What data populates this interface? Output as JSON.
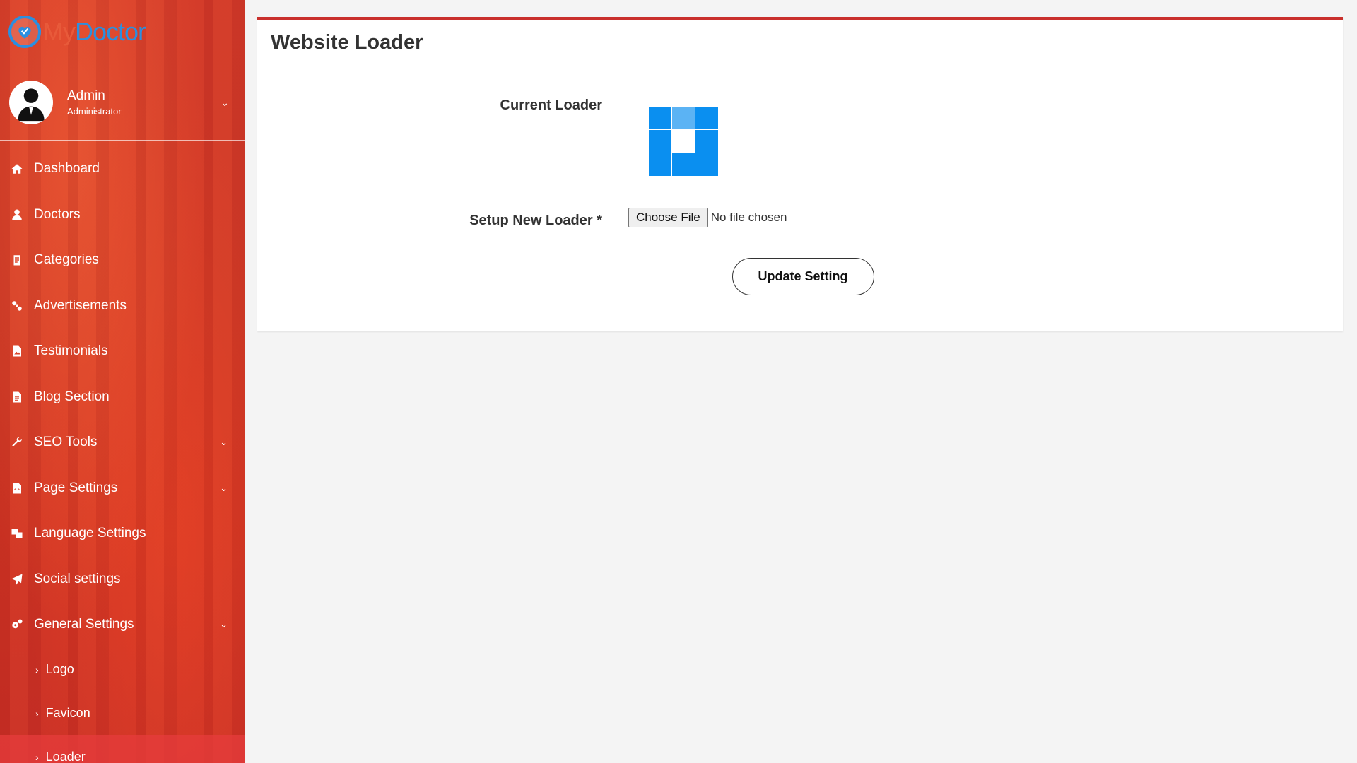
{
  "brand": {
    "part1": "My",
    "part2": "Doctor"
  },
  "user": {
    "name": "Admin",
    "role": "Administrator"
  },
  "menu": [
    {
      "label": "Dashboard",
      "icon": "home-icon"
    },
    {
      "label": "Doctors",
      "icon": "doctor-icon"
    },
    {
      "label": "Categories",
      "icon": "clipboard-icon"
    },
    {
      "label": "Advertisements",
      "icon": "link-icon"
    },
    {
      "label": "Testimonials",
      "icon": "image-file-icon"
    },
    {
      "label": "Blog Section",
      "icon": "document-icon"
    },
    {
      "label": "SEO Tools",
      "icon": "wrench-icon"
    },
    {
      "label": "Page Settings",
      "icon": "code-file-icon"
    },
    {
      "label": "Language Settings",
      "icon": "language-icon"
    },
    {
      "label": "Social settings",
      "icon": "paper-plane-icon"
    },
    {
      "label": "General Settings",
      "icon": "cogs-icon"
    }
  ],
  "submenu": [
    {
      "label": "Logo"
    },
    {
      "label": "Favicon"
    },
    {
      "label": "Loader"
    }
  ],
  "page": {
    "title": "Website Loader",
    "current_loader_label": "Current Loader",
    "new_loader_label": "Setup New Loader *",
    "file_button": "Choose File",
    "file_status": "No file chosen",
    "submit": "Update Setting"
  },
  "colors": {
    "accent": "#c9302c",
    "loader_blue": "#0a8ff0",
    "loader_light": "#5bb3f4"
  }
}
